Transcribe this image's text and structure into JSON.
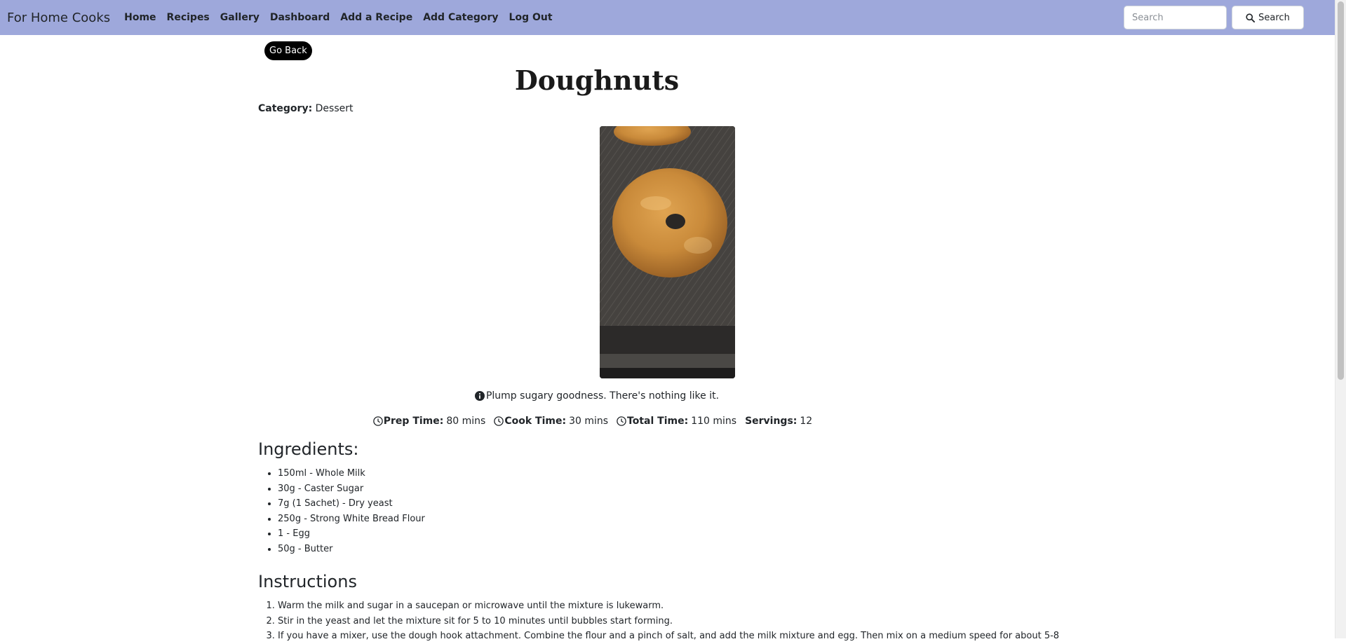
{
  "navbar": {
    "brand": "For Home Cooks",
    "links": [
      "Home",
      "Recipes",
      "Gallery",
      "Dashboard",
      "Add a Recipe",
      "Add Category",
      "Log Out"
    ],
    "search_placeholder": "Search",
    "search_button": "Search"
  },
  "recipe": {
    "go_back": "Go Back",
    "title": "Doughnuts",
    "category_label": "Category:",
    "category": "Dessert",
    "description": "Plump sugary goodness. There's nothing like it.",
    "prep_label": "Prep Time:",
    "prep_value": "80 mins",
    "cook_label": "Cook Time:",
    "cook_value": "30 mins",
    "total_label": "Total Time:",
    "total_value": "110 mins",
    "servings_label": "Servings:",
    "servings_value": "12",
    "ingredients_heading": "Ingredients:",
    "ingredients": [
      "150ml - Whole Milk",
      "30g - Caster Sugar",
      "7g (1 Sachet) - Dry yeast",
      "250g - Strong White Bread Flour",
      "1 - Egg",
      "50g - Butter"
    ],
    "instructions_heading": "Instructions",
    "instructions": [
      "Warm the milk and sugar in a saucepan or microwave until the mixture is lukewarm.",
      "Stir in the yeast and let the mixture sit for 5 to 10 minutes until bubbles start forming.",
      "If you have a mixer, use the dough hook attachment. Combine the flour and a pinch of salt, and add the milk mixture and egg. Then mix on a medium speed for about 5-8"
    ]
  },
  "colors": {
    "navbar_bg": "#9ea8db",
    "go_back_bg": "#000000"
  }
}
